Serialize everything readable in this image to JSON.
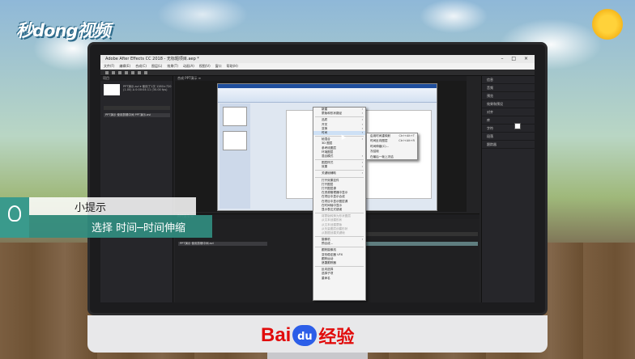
{
  "brand": {
    "logo_text": "秒dong视频",
    "footer_baidu": "Bai",
    "footer_du": "du",
    "footer_jingyan": "经验"
  },
  "app": {
    "title": "Adobe After Effects CC 2018 - 无标题项目.aep *",
    "window_controls": "– □ ×",
    "menus": [
      "文件(F)",
      "编辑(E)",
      "合成(C)",
      "图层(L)",
      "效果(T)",
      "动画(A)",
      "视图(V)",
      "窗口",
      "帮助(H)"
    ]
  },
  "project_panel": {
    "tab": "项目",
    "thumb_text": "PPT演示.avi ▾ 使用了1次 1280×720 (1.00) Δ 0:00:04:11 (30.00 fps)",
    "row": "PPT演示 使用剪辑中间 PPT演示.avi"
  },
  "composition": {
    "tab": "合成 PPT演示 ≡"
  },
  "context_menu": {
    "items": [
      {
        "label": "新建",
        "arrow": "›"
      },
      {
        "label": "蒙版和形状路径",
        "arrow": "›"
      },
      {
        "label": "品质",
        "arrow": "›"
      },
      {
        "label": "开关",
        "arrow": "›"
      },
      {
        "label": "变换",
        "arrow": "›"
      },
      {
        "label": "时间",
        "arrow": "›",
        "selected": true
      },
      {
        "label": "帧混合",
        "arrow": "›"
      },
      {
        "label": "3D 图层"
      },
      {
        "label": "参考线图层"
      },
      {
        "label": "环境图层"
      },
      {
        "label": "混合模式",
        "arrow": "›"
      },
      {
        "label": "图层样式",
        "arrow": "›"
      },
      {
        "label": "效果",
        "arrow": "›"
      },
      {
        "label": "关键帧辅助",
        "arrow": "›"
      },
      {
        "label": "打开效果控件"
      },
      {
        "label": "打开图层"
      },
      {
        "label": "打开图层源"
      },
      {
        "label": "在资源管理器中显示"
      },
      {
        "label": "在项目中显示合成"
      },
      {
        "label": "在项目中显示图层源"
      },
      {
        "label": "在时间轴中显示"
      },
      {
        "label": "显示表达式错误"
      },
      {
        "label": "将蒙版转换为形状图层",
        "disabled": true
      },
      {
        "label": "从文本创建形状",
        "disabled": true
      },
      {
        "label": "从文本创建蒙版",
        "disabled": true
      },
      {
        "label": "从矢量图层创建形状",
        "disabled": true
      },
      {
        "label": "从数据创建关键帧",
        "disabled": true
      },
      {
        "label": "摄像机",
        "arrow": "›"
      },
      {
        "label": "预合成..."
      },
      {
        "label": "跟踪摄像机"
      },
      {
        "label": "变形稳定器 VFX"
      },
      {
        "label": "跟踪运动"
      },
      {
        "label": "遮罩跟踪器"
      },
      {
        "label": "反向选择"
      },
      {
        "label": "选择子项"
      },
      {
        "label": "重命名"
      }
    ]
  },
  "submenu": {
    "items": [
      {
        "label": "启用时间重映射",
        "shortcut": "Ctrl+Alt+T"
      },
      {
        "label": "时间反向图层",
        "shortcut": "Ctrl+Alt+R"
      },
      {
        "label": "时间伸缩(C)..."
      },
      {
        "label": "冻结帧"
      },
      {
        "label": "在最后一帧上冻结"
      }
    ]
  },
  "right_panel": {
    "items": [
      "信息",
      "音频",
      "预览",
      "效果和预设",
      "对齐",
      "库",
      "字符",
      "段落",
      "跟踪器"
    ]
  },
  "timeline": {
    "tab": "PPT演示 ≡",
    "layer": "PPT演示 使用剪辑中间.avi"
  },
  "tip": {
    "title": "小提示",
    "text": "选择 时间─时间伸缩"
  },
  "colors": {
    "tip_accent": "#318d80",
    "ae_dark": "#232325",
    "baidu_red": "#e10b0b",
    "baidu_blue": "#2c5ee8"
  }
}
